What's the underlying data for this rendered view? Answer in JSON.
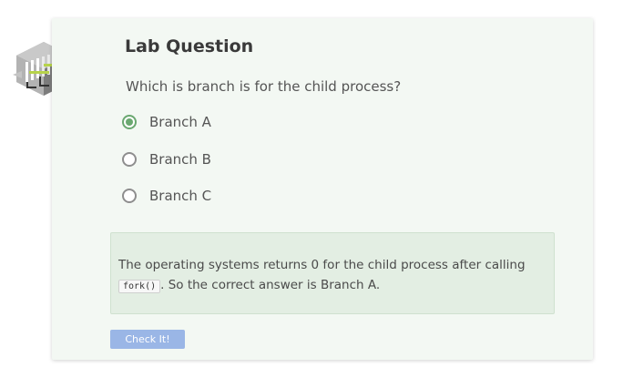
{
  "lab": {
    "title": "Lab Question",
    "question": "Which is branch is for the child process?",
    "options": [
      {
        "label": "Branch A",
        "selected": true
      },
      {
        "label": "Branch B",
        "selected": false
      },
      {
        "label": "Branch C",
        "selected": false
      }
    ],
    "feedback": {
      "text_before": "The operating systems returns 0 for the child process after calling",
      "code": "fork()",
      "text_after": ". So the correct answer is Branch A."
    },
    "check_button_label": "Check It!"
  },
  "colors": {
    "card_background": "#f3f8f3",
    "feedback_background": "#e3eee3",
    "selected_radio": "#6aa870",
    "button": "#9ab6e6"
  },
  "icons": {
    "logo": "server-rack-cube-icon"
  }
}
